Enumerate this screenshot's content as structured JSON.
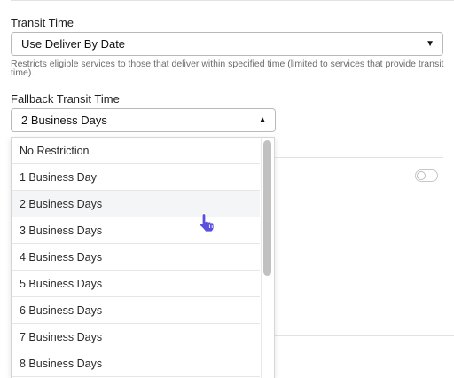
{
  "transit_time": {
    "label": "Transit Time",
    "value": "Use Deliver By Date",
    "helper": "Restricts eligible services to those that deliver within specified time (limited to services that provide transit time)."
  },
  "fallback_transit_time": {
    "label": "Fallback Transit Time",
    "value": "2 Business Days",
    "options": [
      "No Restriction",
      "1 Business Day",
      "2 Business Days",
      "3 Business Days",
      "4 Business Days",
      "5 Business Days",
      "6 Business Days",
      "7 Business Days",
      "8 Business Days"
    ]
  },
  "toggle": {
    "on": false
  },
  "icons": {
    "select_arrow_closed": "caret-down-icon",
    "select_arrow_open": "caret-up-icon",
    "cursor": "hand-pointer-icon"
  },
  "colors": {
    "cursor": "#5b4fe0",
    "selected_option_bg": "#f4f5f7"
  }
}
